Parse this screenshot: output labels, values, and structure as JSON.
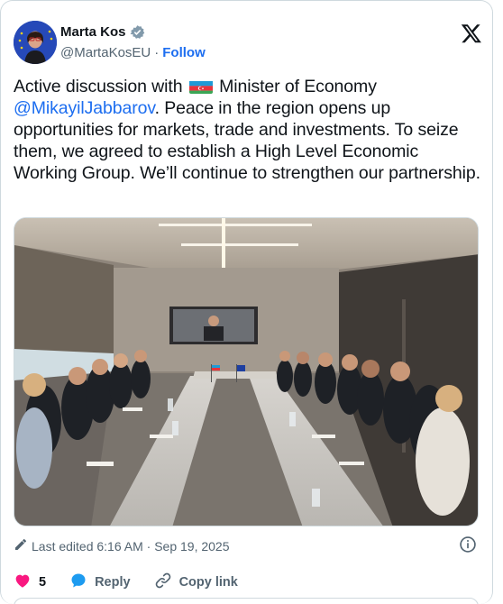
{
  "author": {
    "display_name": "Marta Kos",
    "handle": "@MartaKosEU",
    "separator": "·",
    "follow_label": "Follow"
  },
  "tweet": {
    "text_part1": "Active discussion with ",
    "flag_icon": "azerbaijan-flag-icon",
    "text_part2": " Minister of Economy ",
    "mention": "@MikayilJabbarov",
    "text_part3": ". Peace in the region opens up opportunities for markets, trade and investments. To seize them, we agreed to establish a High Level Economic Working Group. We’ll continue to strengthen our partnership."
  },
  "meta": {
    "edited_label": "Last edited 6:16 AM · Sep 19, 2025"
  },
  "actions": {
    "like_count": "5",
    "reply_label": "Reply",
    "copy_link_label": "Copy link"
  },
  "colors": {
    "accent": "#1d6ef0",
    "like": "#f91880",
    "reply_icon": "#1d9bf0",
    "muted": "#536471"
  }
}
